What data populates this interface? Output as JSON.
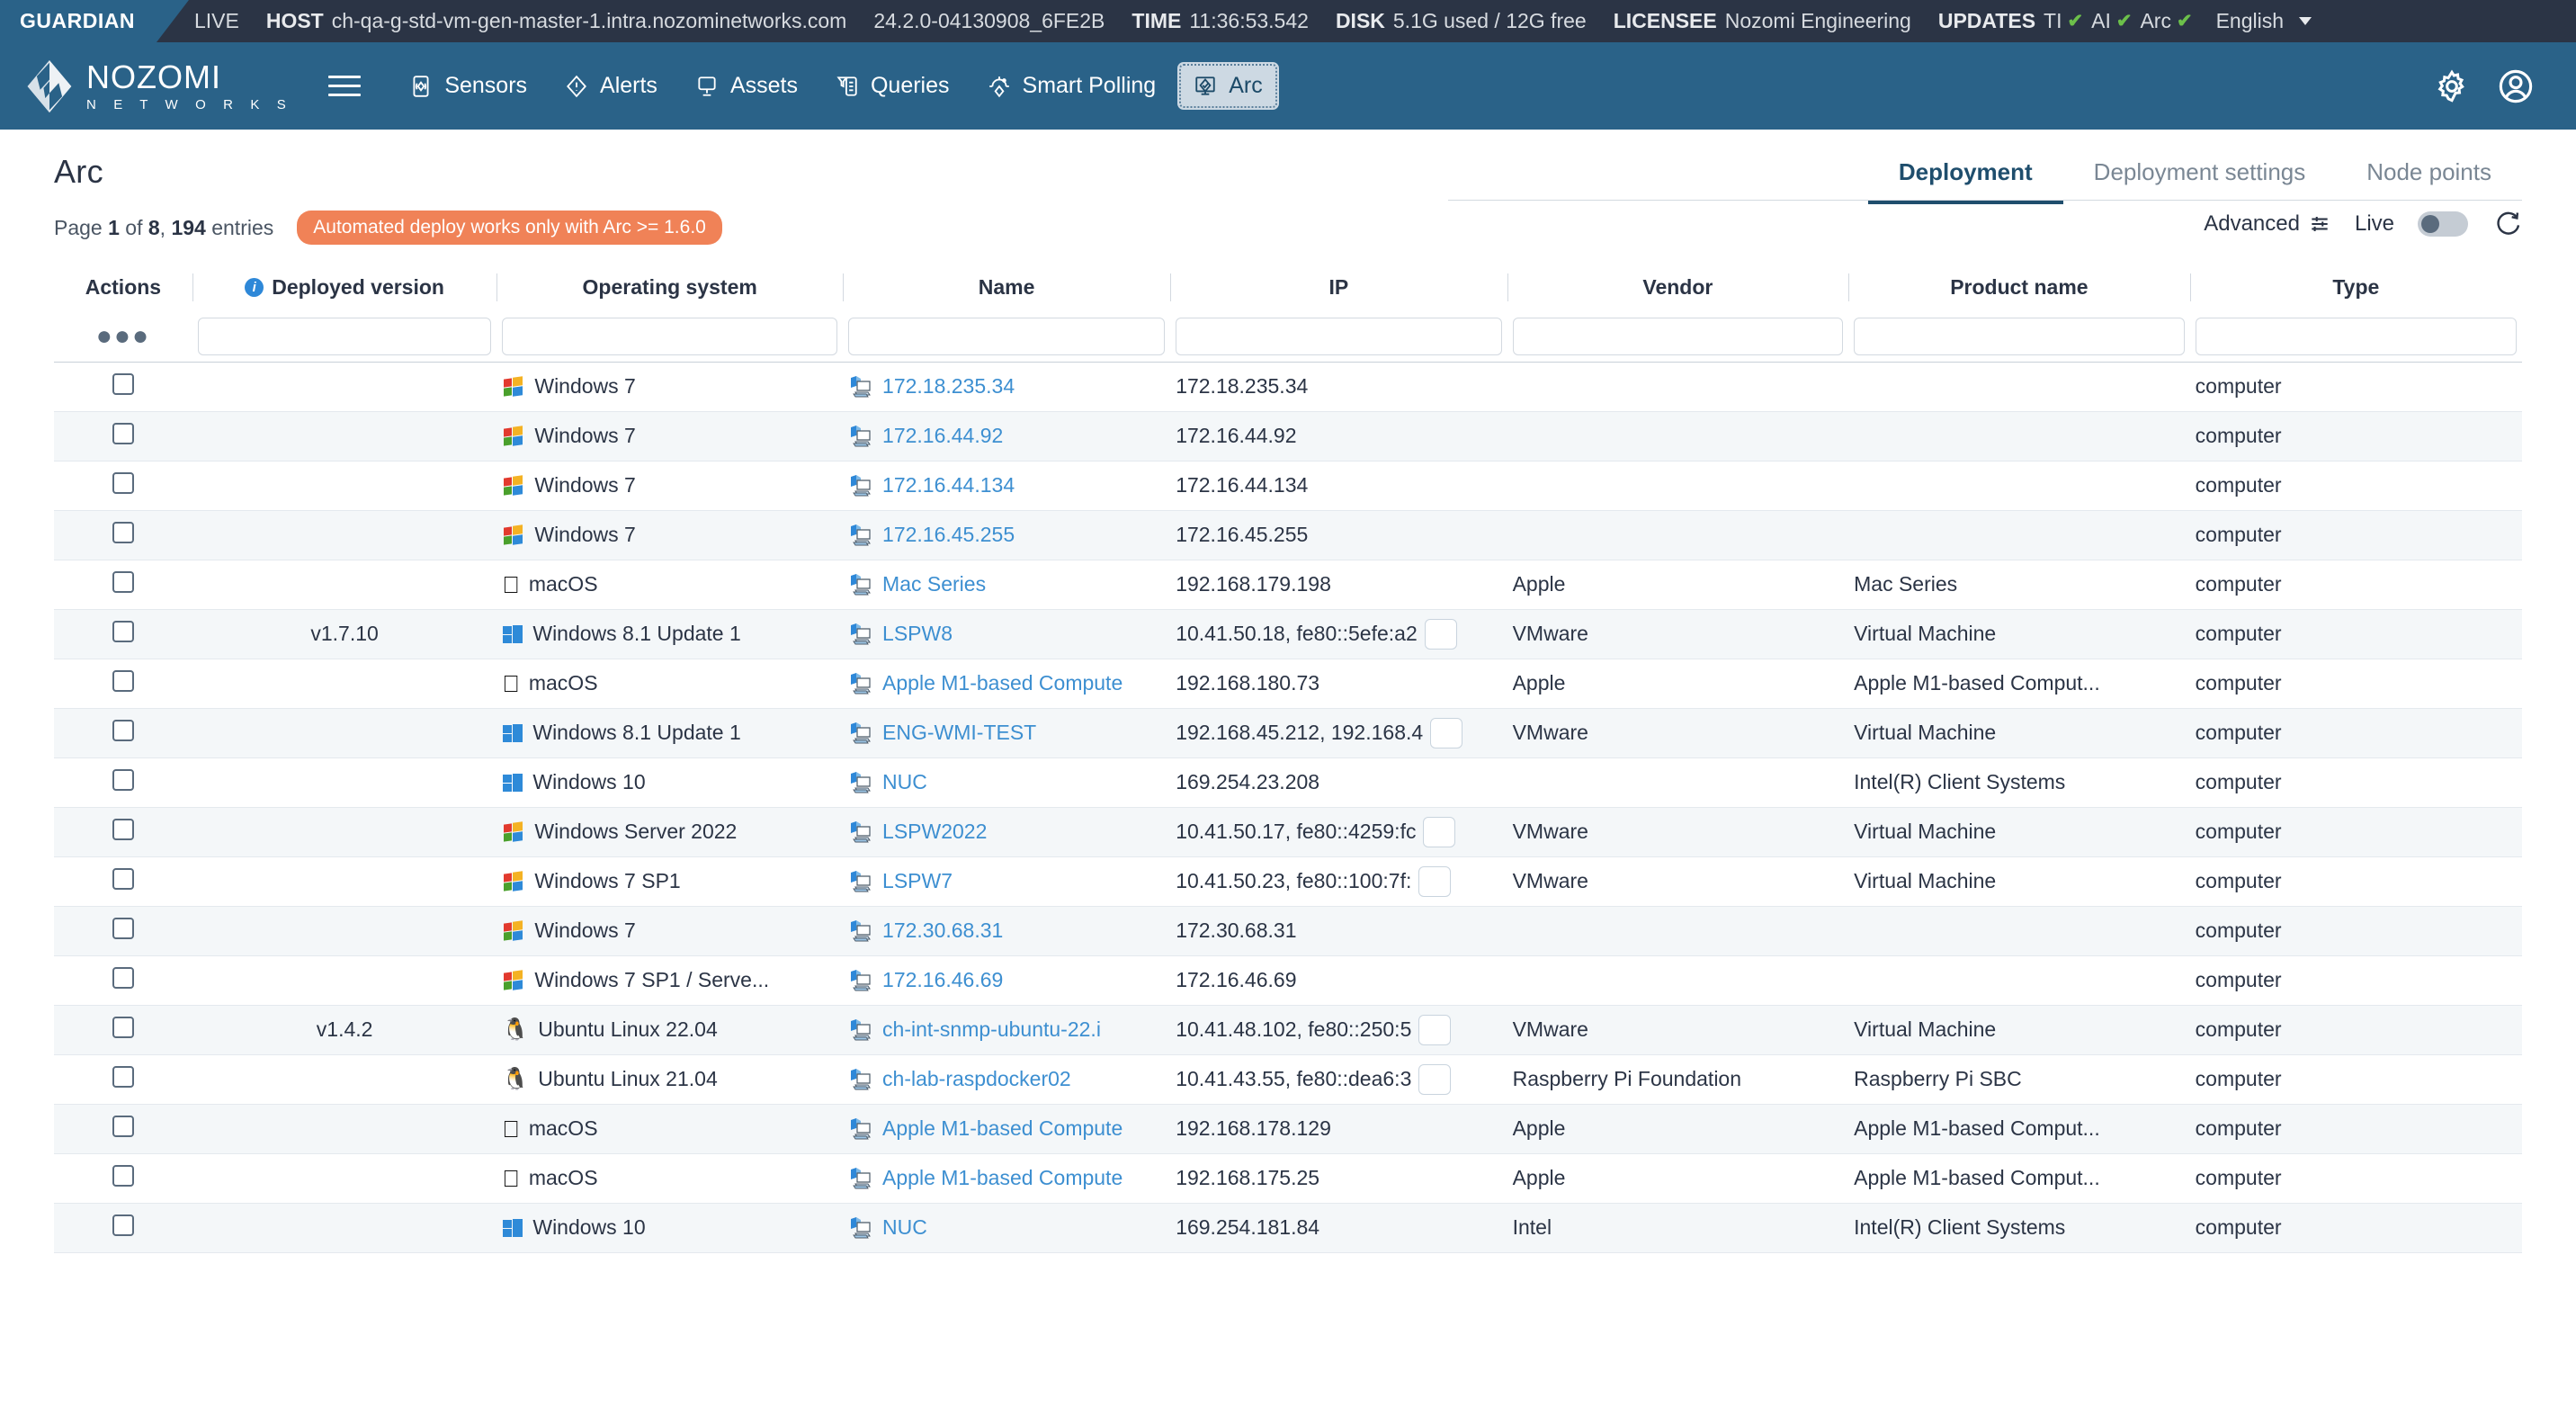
{
  "statusbar": {
    "product": "GUARDIAN",
    "live": "LIVE",
    "host_key": "HOST",
    "host_val": "ch-qa-g-std-vm-gen-master-1.intra.nozominetworks.com",
    "build": "24.2.0-04130908_6FE2B",
    "time_key": "TIME",
    "time_val": "11:36:53.542",
    "disk_key": "DISK",
    "disk_val": "5.1G used / 12G free",
    "licensee_key": "LICENSEE",
    "licensee_val": "Nozomi Engineering",
    "updates_key": "UPDATES",
    "updates": [
      {
        "label": "TI",
        "state": "✔"
      },
      {
        "label": "AI",
        "state": "✔"
      },
      {
        "label": "Arc",
        "state": "✔"
      }
    ],
    "language": "English"
  },
  "brand": {
    "name": "NOZOMI",
    "sub": "N E T W O R K S"
  },
  "nav": {
    "items": [
      {
        "label": "Sensors",
        "icon": "sensors-icon",
        "active": false
      },
      {
        "label": "Alerts",
        "icon": "alerts-icon",
        "active": false
      },
      {
        "label": "Assets",
        "icon": "assets-icon",
        "active": false
      },
      {
        "label": "Queries",
        "icon": "queries-icon",
        "active": false
      },
      {
        "label": "Smart Polling",
        "icon": "smart-polling-icon",
        "active": false
      },
      {
        "label": "Arc",
        "icon": "arc-icon",
        "active": true
      }
    ],
    "settings_icon": "gear-icon",
    "account_icon": "user-account-icon"
  },
  "page": {
    "title": "Arc",
    "pagination": {
      "prefix": "Page",
      "current": "1",
      "of": "of",
      "total": "8",
      "comma": ",",
      "entries_count": "194",
      "entries_label": "entries"
    },
    "warning_pill": "Automated deploy works only with Arc >= 1.6.0",
    "tabs": [
      {
        "label": "Deployment",
        "active": true
      },
      {
        "label": "Deployment settings",
        "active": false
      },
      {
        "label": "Node points",
        "active": false
      }
    ],
    "advanced_label": "Advanced",
    "live_label": "Live",
    "live_on": false
  },
  "table": {
    "columns": [
      {
        "key": "actions",
        "label": "Actions",
        "info": false
      },
      {
        "key": "deployed_version",
        "label": "Deployed version",
        "info": true
      },
      {
        "key": "operating_system",
        "label": "Operating system",
        "info": false
      },
      {
        "key": "name",
        "label": "Name",
        "info": false
      },
      {
        "key": "ip",
        "label": "IP",
        "info": false
      },
      {
        "key": "vendor",
        "label": "Vendor",
        "info": false
      },
      {
        "key": "product_name",
        "label": "Product name",
        "info": false
      },
      {
        "key": "type",
        "label": "Type",
        "info": false
      }
    ],
    "filter_placeholders": {
      "deployed_version": "",
      "operating_system": "",
      "name": "",
      "ip": "",
      "vendor": "",
      "product_name": "",
      "type": ""
    },
    "actions_menu_icon": "ellipsis-icon",
    "rows": [
      {
        "checked": false,
        "deployed_version": "",
        "os": "Windows 7",
        "os_icon": "windows7-icon",
        "name": "172.18.235.34",
        "ip": "172.18.235.34",
        "ip_more": false,
        "vendor": "",
        "product_name": "",
        "type": "computer"
      },
      {
        "checked": false,
        "deployed_version": "",
        "os": "Windows 7",
        "os_icon": "windows7-icon",
        "name": "172.16.44.92",
        "ip": "172.16.44.92",
        "ip_more": false,
        "vendor": "",
        "product_name": "",
        "type": "computer"
      },
      {
        "checked": false,
        "deployed_version": "",
        "os": "Windows 7",
        "os_icon": "windows7-icon",
        "name": "172.16.44.134",
        "ip": "172.16.44.134",
        "ip_more": false,
        "vendor": "",
        "product_name": "",
        "type": "computer"
      },
      {
        "checked": false,
        "deployed_version": "",
        "os": "Windows 7",
        "os_icon": "windows7-icon",
        "name": "172.16.45.255",
        "ip": "172.16.45.255",
        "ip_more": false,
        "vendor": "",
        "product_name": "",
        "type": "computer"
      },
      {
        "checked": false,
        "deployed_version": "",
        "os": "macOS",
        "os_icon": "apple-icon",
        "name": "Mac Series",
        "ip": "192.168.179.198",
        "ip_more": false,
        "vendor": "Apple",
        "product_name": "Mac Series",
        "type": "computer"
      },
      {
        "checked": false,
        "deployed_version": "v1.7.10",
        "os": "Windows 8.1 Update 1",
        "os_icon": "windows10-icon",
        "name": "LSPW8",
        "ip": "10.41.50.18, fe80::5efe:a2",
        "ip_more": true,
        "vendor": "VMware",
        "product_name": "Virtual Machine",
        "type": "computer"
      },
      {
        "checked": false,
        "deployed_version": "",
        "os": "macOS",
        "os_icon": "apple-icon",
        "name": "Apple M1-based Compute",
        "ip": "192.168.180.73",
        "ip_more": false,
        "vendor": "Apple",
        "product_name": "Apple M1-based Comput...",
        "type": "computer"
      },
      {
        "checked": false,
        "deployed_version": "",
        "os": "Windows 8.1 Update 1",
        "os_icon": "windows10-icon",
        "name": "ENG-WMI-TEST",
        "ip": "192.168.45.212, 192.168.4",
        "ip_more": true,
        "vendor": "VMware",
        "product_name": "Virtual Machine",
        "type": "computer"
      },
      {
        "checked": false,
        "deployed_version": "",
        "os": "Windows 10",
        "os_icon": "windows10-icon",
        "name": "NUC",
        "ip": "169.254.23.208",
        "ip_more": false,
        "vendor": "",
        "product_name": "Intel(R) Client Systems",
        "type": "computer"
      },
      {
        "checked": false,
        "deployed_version": "",
        "os": "Windows Server 2022",
        "os_icon": "windows7-icon",
        "name": "LSPW2022",
        "ip": "10.41.50.17, fe80::4259:fc",
        "ip_more": true,
        "vendor": "VMware",
        "product_name": "Virtual Machine",
        "type": "computer"
      },
      {
        "checked": false,
        "deployed_version": "",
        "os": "Windows 7 SP1",
        "os_icon": "windows7-icon",
        "name": "LSPW7",
        "ip": "10.41.50.23, fe80::100:7f:",
        "ip_more": true,
        "vendor": "VMware",
        "product_name": "Virtual Machine",
        "type": "computer"
      },
      {
        "checked": false,
        "deployed_version": "",
        "os": "Windows 7",
        "os_icon": "windows7-icon",
        "name": "172.30.68.31",
        "ip": "172.30.68.31",
        "ip_more": false,
        "vendor": "",
        "product_name": "",
        "type": "computer"
      },
      {
        "checked": false,
        "deployed_version": "",
        "os": "Windows 7 SP1 / Serve...",
        "os_icon": "windows7-icon",
        "name": "172.16.46.69",
        "ip": "172.16.46.69",
        "ip_more": false,
        "vendor": "",
        "product_name": "",
        "type": "computer"
      },
      {
        "checked": false,
        "deployed_version": "v1.4.2",
        "os": "Ubuntu Linux 22.04",
        "os_icon": "linux-icon",
        "name": "ch-int-snmp-ubuntu-22.i",
        "ip": "10.41.48.102, fe80::250:5",
        "ip_more": true,
        "vendor": "VMware",
        "product_name": "Virtual Machine",
        "type": "computer"
      },
      {
        "checked": false,
        "deployed_version": "",
        "os": "Ubuntu Linux 21.04",
        "os_icon": "linux-icon",
        "name": "ch-lab-raspdocker02",
        "ip": "10.41.43.55, fe80::dea6:3",
        "ip_more": true,
        "vendor": "Raspberry Pi Foundation",
        "product_name": "Raspberry Pi SBC",
        "type": "computer"
      },
      {
        "checked": false,
        "deployed_version": "",
        "os": "macOS",
        "os_icon": "apple-icon",
        "name": "Apple M1-based Compute",
        "ip": "192.168.178.129",
        "ip_more": false,
        "vendor": "Apple",
        "product_name": "Apple M1-based Comput...",
        "type": "computer"
      },
      {
        "checked": false,
        "deployed_version": "",
        "os": "macOS",
        "os_icon": "apple-icon",
        "name": "Apple M1-based Compute",
        "ip": "192.168.175.25",
        "ip_more": false,
        "vendor": "Apple",
        "product_name": "Apple M1-based Comput...",
        "type": "computer"
      },
      {
        "checked": false,
        "deployed_version": "",
        "os": "Windows 10",
        "os_icon": "windows10-icon",
        "name": "NUC",
        "ip": "169.254.181.84",
        "ip_more": false,
        "vendor": "Intel",
        "product_name": "Intel(R) Client Systems",
        "type": "computer"
      }
    ]
  },
  "colors": {
    "brand_blue": "#2a6288",
    "statusbar_dark": "#2b3445",
    "link_blue": "#3d8fd1",
    "warn_orange": "#f08257",
    "check_green": "#6cc04a"
  }
}
